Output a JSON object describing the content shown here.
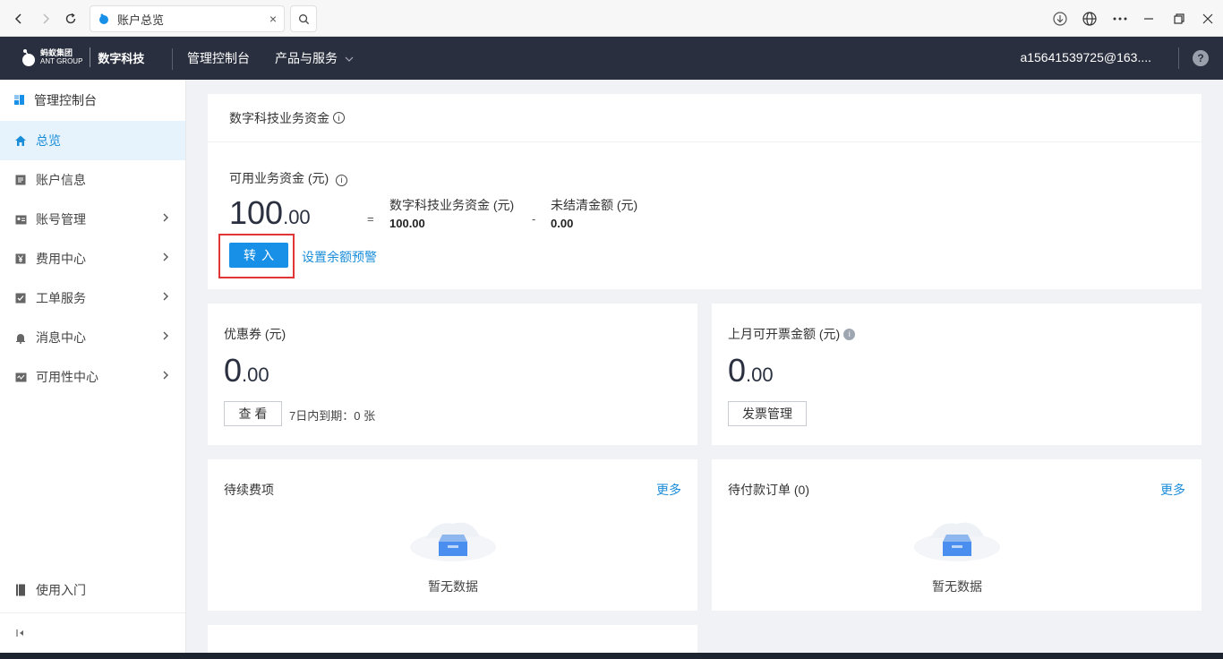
{
  "browser": {
    "tab_title": "账户总览",
    "tab_close": "×"
  },
  "topnav": {
    "logo_cn": "蚂蚁集团",
    "logo_en": "ANT GROUP",
    "brand": "数字科技",
    "items": [
      "管理控制台",
      "产品与服务"
    ],
    "user": "a15641539725@163....",
    "help": "?"
  },
  "sidebar": {
    "header": "管理控制台",
    "items": [
      {
        "label": "总览",
        "icon": "home-icon",
        "active": true
      },
      {
        "label": "账户信息",
        "icon": "document-icon"
      },
      {
        "label": "账号管理",
        "icon": "id-card-icon",
        "arrow": true
      },
      {
        "label": "费用中心",
        "icon": "yen-icon",
        "arrow": true
      },
      {
        "label": "工单服务",
        "icon": "checklist-icon",
        "arrow": true
      },
      {
        "label": "消息中心",
        "icon": "bell-icon",
        "arrow": true
      },
      {
        "label": "可用性中心",
        "icon": "monitor-icon",
        "arrow": true
      }
    ],
    "bottom": "使用入门"
  },
  "funds": {
    "section_title": "数字科技业务资金",
    "available_label": "可用业务资金 (元)",
    "available_int": "100",
    "available_dec": ".00",
    "eq": "=",
    "minus": "-",
    "biz_label": "数字科技业务资金 (元)",
    "biz_value": "100.00",
    "unsettled_label": "未结清金额 (元)",
    "unsettled_value": "0.00",
    "transfer_button": "转入",
    "alert_link": "设置余额预警"
  },
  "coupon": {
    "title": "优惠券 (元)",
    "int": "0",
    "dec": ".00",
    "view_button": "查 看",
    "expiry_note": "7日内到期：0 张"
  },
  "invoice": {
    "title": "上月可开票金额 (元)",
    "int": "0",
    "dec": ".00",
    "manage_button": "发票管理"
  },
  "pending_renewal": {
    "title": "待续费项",
    "more": "更多",
    "empty": "暂无数据"
  },
  "pending_orders": {
    "title": "待付款订单 (0)",
    "more": "更多",
    "empty": "暂无数据"
  },
  "colors": {
    "nav_bg": "#292f3e",
    "accent": "#1890e8",
    "highlight": "#e23636"
  }
}
